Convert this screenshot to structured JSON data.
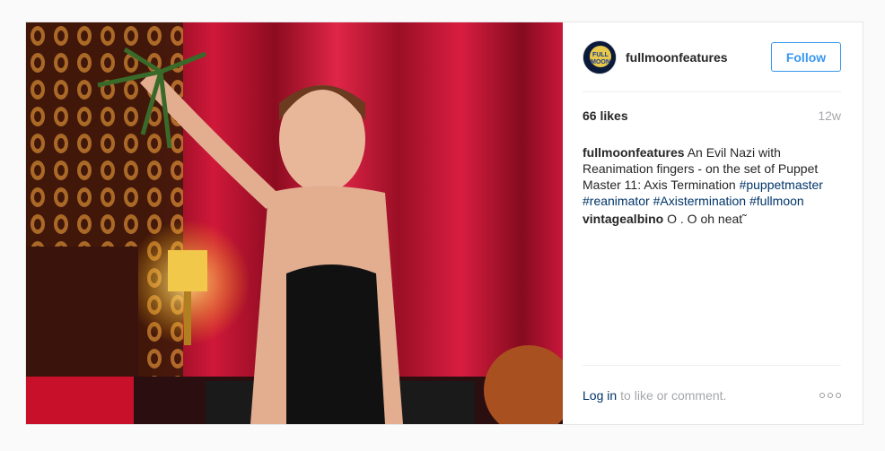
{
  "post": {
    "photo_alt": "",
    "author": {
      "username": "fullmoonfeatures",
      "avatar_text_1": "FULL",
      "avatar_text_2": "MOON"
    },
    "follow_label": "Follow",
    "likes": "66 likes",
    "time_ago": "12w",
    "comments": [
      {
        "user": "fullmoonfeatures",
        "text": "An Evil Nazi with Reanimation fingers - on the set of Puppet Master 11: Axis Termination",
        "tags": [
          "#puppetmaster",
          "#reanimator",
          "#Axistermination",
          "#fullmoon"
        ]
      },
      {
        "user": "vintagealbino",
        "text": "O . O oh neat˜"
      }
    ],
    "footer": {
      "login_label": "Log in",
      "prompt": "to like or comment.",
      "more_icon": "more-options-icon"
    }
  },
  "colors": {
    "link": "#3897f0",
    "hashtag": "#003569",
    "muted": "#a5a7aa"
  }
}
